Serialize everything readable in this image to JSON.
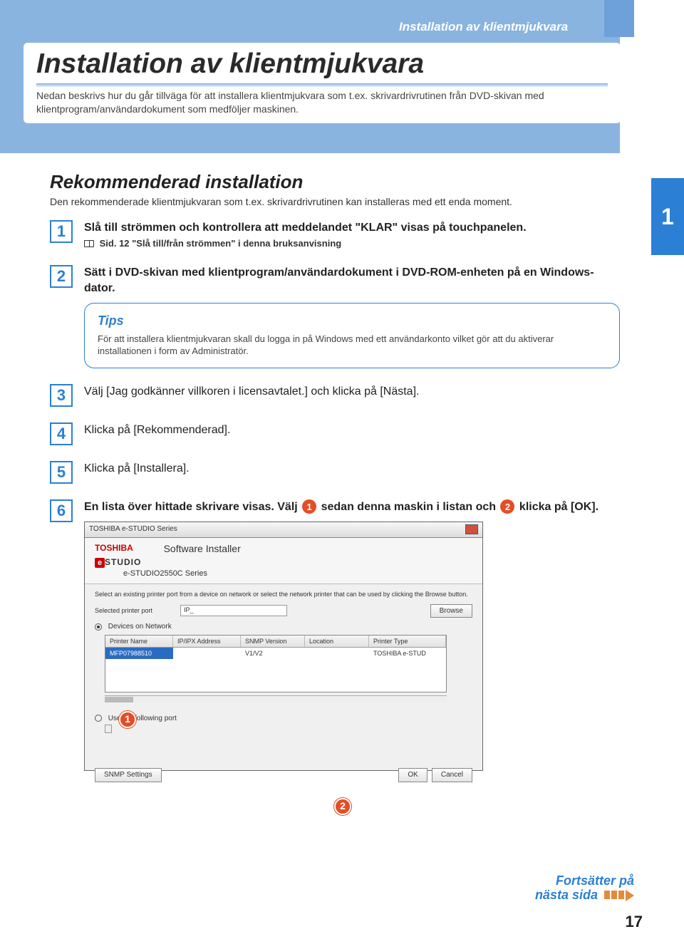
{
  "header": {
    "running": "Installation av klientmjukvara",
    "title": "Installation av klientmjukvara",
    "intro": "Nedan beskrivs hur du går tillväga för att installera klientmjukvara som t.ex. skrivardrivrutinen från DVD-skivan med klientprogram/användardokument som medföljer maskinen."
  },
  "section": {
    "heading": "Rekommenderad installation",
    "intro": "Den rekommenderade klientmjukvaran som t.ex. skrivardrivrutinen kan installeras med ett enda moment.",
    "chapter_badge": "1"
  },
  "steps": [
    {
      "n": "1",
      "text": "Slå till strömmen och kontrollera att meddelandet \"KLAR\" visas på touchpanelen.",
      "ref": "Sid. 12 \"Slå till/från strömmen\" i denna bruksanvisning"
    },
    {
      "n": "2",
      "text": "Sätt i DVD-skivan med klientprogram/användardokument i DVD-ROM-enheten på en Windows-dator.",
      "tips_title": "Tips",
      "tips_text": "För att installera klientmjukvaran skall du logga in på Windows med ett användarkonto vilket gör att du aktiverar installationen i form av Administratör."
    },
    {
      "n": "3",
      "text": "Välj [Jag godkänner villkoren i licensavtalet.] och klicka på [Nästa]."
    },
    {
      "n": "4",
      "text": "Klicka på [Rekommenderad]."
    },
    {
      "n": "5",
      "text": "Klicka på [Installera]."
    },
    {
      "n": "6",
      "pre": "En lista över hittade skrivare visas. Välj ",
      "mid": " sedan denna maskin i listan och ",
      "post": " klicka på [OK].",
      "badge_a": "1",
      "badge_b": "2"
    }
  ],
  "dialog": {
    "window_title": "TOSHIBA e-STUDIO Series",
    "brand": "TOSHIBA",
    "logo_e": "e",
    "logo_text": "STUDIO",
    "app_title": "Software Installer",
    "app_sub": "e-STUDIO2550C Series",
    "desc": "Select an existing printer port from a device on network or select the network printer that can be used by clicking the Browse button.",
    "selected_label": "Selected printer port",
    "selected_value": "IP_",
    "browse": "Browse",
    "radio1": "Devices on Network",
    "headers": {
      "name": "Printer Name",
      "ip": "IP/IPX Address",
      "snmp": "SNMP Version",
      "loc": "Location",
      "type": "Printer Type"
    },
    "row": {
      "name": "MFP07988510",
      "ip": "",
      "snmp": "V1/V2",
      "loc": "",
      "type": "TOSHIBA e-STUD"
    },
    "radio2": "Use the following port",
    "snmp_btn": "SNMP Settings",
    "ok": "OK",
    "cancel": "Cancel",
    "callout1": "1",
    "callout2": "2"
  },
  "footer": {
    "continue1": "Fortsätter på",
    "continue2": "nästa sida",
    "page": "17"
  }
}
